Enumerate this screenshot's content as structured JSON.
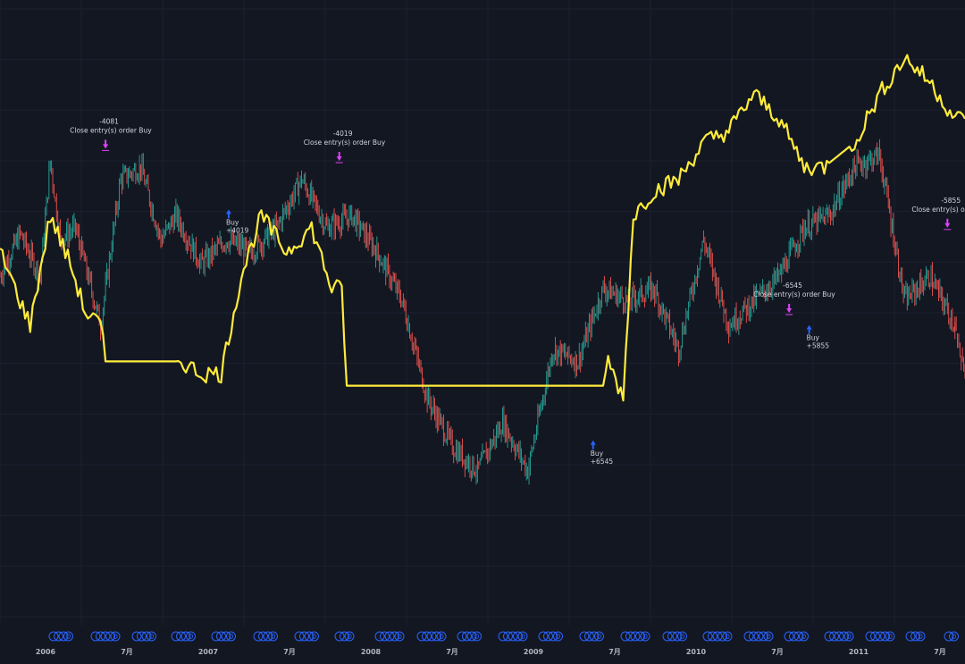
{
  "colors": {
    "background": "#131722",
    "grid": "#1c2030",
    "candle_up": "#26a69a",
    "candle_down": "#ef5350",
    "equity_line": "#ffeb3b",
    "buy_arrow": "#2962ff",
    "close_arrow": "#e040fb",
    "event_marker": "#2962ff",
    "text": "#d1d4dc"
  },
  "x_axis": {
    "ticks": [
      "2006",
      "7月",
      "2007",
      "7月",
      "2008",
      "7月",
      "2009",
      "7月",
      "2010",
      "7月",
      "2011",
      "7月"
    ]
  },
  "chart_data": {
    "type": "line",
    "series": [
      {
        "series_type": "candlestick",
        "price_path": [
          [
            0,
            56
          ],
          [
            4,
            63
          ],
          [
            8,
            56
          ],
          [
            10,
            75
          ],
          [
            12,
            62
          ],
          [
            15,
            64
          ],
          [
            20,
            48
          ],
          [
            22,
            60
          ],
          [
            24,
            72
          ],
          [
            28,
            74
          ],
          [
            32,
            62
          ],
          [
            35,
            66
          ],
          [
            40,
            58
          ],
          [
            45,
            62
          ],
          [
            50,
            60
          ],
          [
            55,
            64
          ],
          [
            60,
            72
          ],
          [
            65,
            64
          ],
          [
            70,
            66
          ],
          [
            75,
            60
          ],
          [
            80,
            52
          ],
          [
            85,
            36
          ],
          [
            90,
            28
          ],
          [
            95,
            24
          ],
          [
            100,
            32
          ],
          [
            105,
            24
          ],
          [
            110,
            44
          ],
          [
            115,
            42
          ],
          [
            120,
            54
          ],
          [
            125,
            52
          ],
          [
            130,
            54
          ],
          [
            135,
            44
          ],
          [
            140,
            62
          ],
          [
            145,
            48
          ],
          [
            150,
            52
          ],
          [
            155,
            56
          ],
          [
            160,
            64
          ],
          [
            165,
            66
          ],
          [
            170,
            74
          ],
          [
            175,
            76
          ],
          [
            180,
            52
          ],
          [
            185,
            56
          ],
          [
            190,
            48
          ]
        ],
        "end_stub": 40
      },
      {
        "series_type": "equity",
        "equity_path": [
          [
            0,
            60
          ],
          [
            6,
            48
          ],
          [
            10,
            66
          ],
          [
            14,
            58
          ],
          [
            17,
            50
          ],
          [
            20,
            48
          ],
          [
            21,
            42
          ],
          [
            36,
            42
          ],
          [
            40,
            40
          ],
          [
            44,
            40
          ],
          [
            48,
            56
          ],
          [
            52,
            66
          ],
          [
            57,
            60
          ],
          [
            62,
            64
          ],
          [
            66,
            54
          ],
          [
            68,
            54
          ],
          [
            69,
            38
          ],
          [
            120,
            38
          ],
          [
            121,
            42
          ],
          [
            124,
            36
          ],
          [
            126,
            66
          ],
          [
            130,
            70
          ],
          [
            135,
            72
          ],
          [
            140,
            78
          ],
          [
            145,
            80
          ],
          [
            150,
            86
          ],
          [
            155,
            82
          ],
          [
            160,
            74
          ],
          [
            164,
            74
          ],
          [
            170,
            78
          ],
          [
            175,
            86
          ],
          [
            180,
            92
          ],
          [
            185,
            88
          ],
          [
            190,
            82
          ],
          [
            192,
            82
          ]
        ]
      }
    ],
    "annotations": [
      {
        "side": "close",
        "lines": [
          "-4081",
          "Close entry(s) order Buy"
        ]
      },
      {
        "side": "buy",
        "lines": [
          "Buy",
          "+4019"
        ]
      },
      {
        "side": "close",
        "lines": [
          "-4019",
          "Close entry(s) order Buy"
        ]
      },
      {
        "side": "buy",
        "lines": [
          "Buy",
          "+6545"
        ]
      },
      {
        "side": "close",
        "lines": [
          "-6545",
          "Close entry(s) order Buy"
        ]
      },
      {
        "side": "buy",
        "lines": [
          "Buy",
          "+5855"
        ]
      },
      {
        "side": "close",
        "lines": [
          "-5855",
          "Close entry(s) order Buy"
        ]
      }
    ],
    "event_marker_glyph": "D",
    "grid": true,
    "legend": "none"
  }
}
